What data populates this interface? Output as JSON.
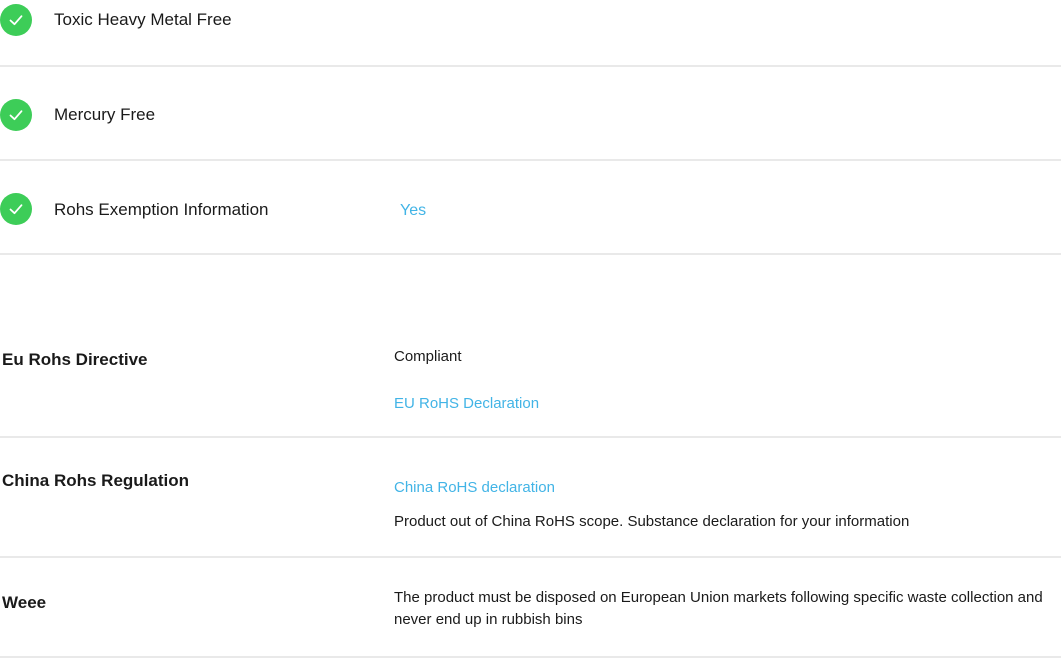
{
  "environmental_checks": [
    {
      "label": "Toxic Heavy Metal Free",
      "value": "",
      "icon": "check-circle-icon"
    },
    {
      "label": "Mercury Free",
      "value": "",
      "icon": "check-circle-icon"
    },
    {
      "label": "Rohs Exemption Information",
      "value": "Yes",
      "icon": "check-circle-icon"
    }
  ],
  "regulations": {
    "eu_rohs": {
      "label": "Eu Rohs Directive",
      "status": "Compliant",
      "link": "EU RoHS Declaration"
    },
    "china_rohs": {
      "label": "China Rohs Regulation",
      "link": "China RoHS declaration",
      "note": "Product out of China RoHS scope. Substance declaration for your information"
    },
    "weee": {
      "label": "Weee",
      "text": "The product must be disposed on European Union markets following specific waste collection and never end up in rubbish bins"
    }
  },
  "colors": {
    "check_green": "#3dcd58",
    "link_blue": "#42b4e6",
    "divider": "#e9e9e9"
  }
}
